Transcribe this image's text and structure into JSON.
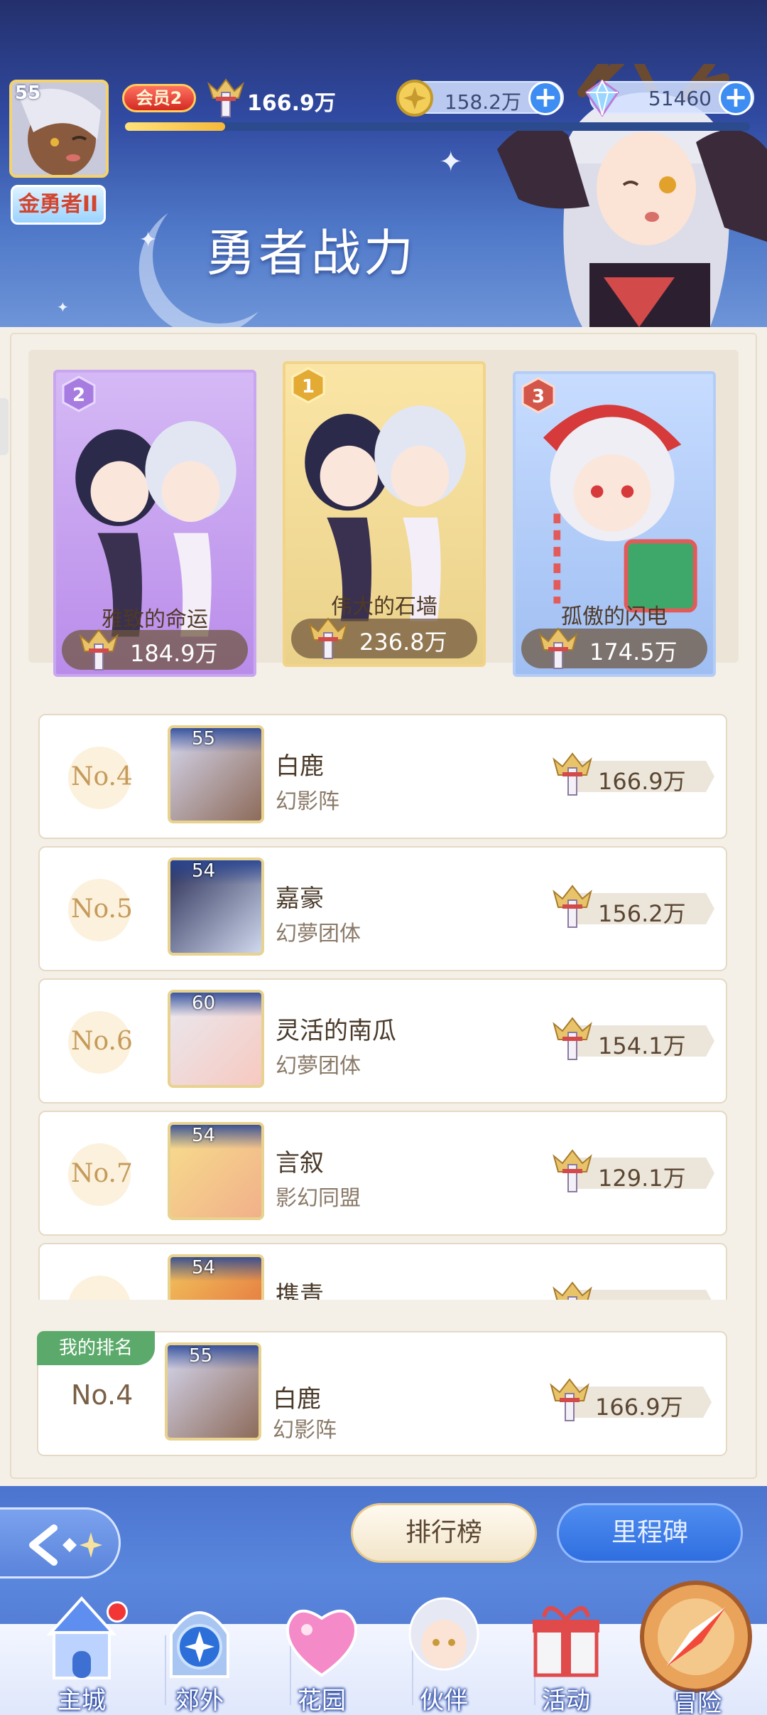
{
  "header": {
    "player_level": "55",
    "rank_title": "金勇者II",
    "vip_label": "会员2",
    "power": "166.9万",
    "exp_progress": 0.16,
    "gold": "158.2万",
    "diamond": "51460",
    "plus_label": "+",
    "page_title": "勇者战力"
  },
  "podium": [
    {
      "rank": "2",
      "name": "雅致的命运",
      "power": "184.9万"
    },
    {
      "rank": "1",
      "name": "伟大的石墙",
      "power": "236.8万"
    },
    {
      "rank": "3",
      "name": "孤傲的闪电",
      "power": "174.5万"
    }
  ],
  "ranking": [
    {
      "no": "No.4",
      "level": "55",
      "name": "白鹿",
      "guild": "幻影阵",
      "power": "166.9万"
    },
    {
      "no": "No.5",
      "level": "54",
      "name": "嘉豪",
      "guild": "幻夢团体",
      "power": "156.2万"
    },
    {
      "no": "No.6",
      "level": "60",
      "name": "灵活的南瓜",
      "guild": "幻夢团体",
      "power": "154.1万"
    },
    {
      "no": "No.7",
      "level": "54",
      "name": "言叙",
      "guild": "影幻同盟",
      "power": "129.1万"
    },
    {
      "no": "",
      "level": "54",
      "name": "携青",
      "guild": "",
      "power": ""
    }
  ],
  "my_rank": {
    "tag": "我的排名",
    "no": "No.4",
    "level": "55",
    "name": "白鹿",
    "guild": "幻影阵",
    "power": "166.9万"
  },
  "bottom": {
    "tab_rank": "排行榜",
    "tab_milestone": "里程碑",
    "nav": [
      "主城",
      "郊外",
      "花园",
      "伙伴",
      "活动",
      "冒险"
    ]
  },
  "icons": {
    "power": "crown-sword-icon",
    "gold": "gold-coin-icon",
    "diamond": "diamond-icon",
    "back": "back-arrow-icon"
  },
  "colors": {
    "accent_blue": "#3e8df2",
    "gold_text": "#c59a5a",
    "my_rank_green": "#5caa6b",
    "vip_red": "#d32a22"
  }
}
